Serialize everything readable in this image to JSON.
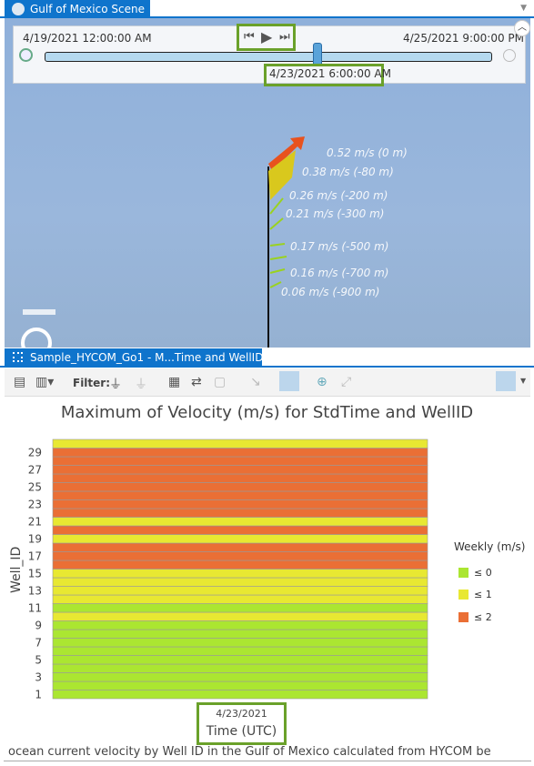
{
  "scene_tab": {
    "title": "Gulf of Mexico Scene",
    "close": "✕"
  },
  "time_slider": {
    "start": "4/19/2021 12:00:00 AM",
    "end": "4/25/2021 9:00:00 PM",
    "current": "4/23/2021 6:00:00 AM",
    "position_fraction": 0.61,
    "prev": "⏮",
    "play": "▶",
    "next": "⏭"
  },
  "scene_labels": [
    "0.52 m/s (0 m)",
    "0.38 m/s (-80 m)",
    "0.26 m/s (-200 m)",
    "0.21 m/s (-300 m)",
    "0.17 m/s (-500 m)",
    "0.16 m/s (-700 m)",
    "0.06 m/s (-900 m)"
  ],
  "chart_tab": {
    "title": "Sample_HYCOM_Go1 - M...Time and WellID",
    "close": "✕"
  },
  "toolbar": {
    "filter_label": "Filter:"
  },
  "chart_data": {
    "type": "heatmap",
    "title": "Maximum of Velocity (m/s) for StdTime and WellID",
    "xlabel": "Time (UTC)",
    "ylabel": "Well_ID",
    "x_categories": [
      "4/23/2021"
    ],
    "y_ticks": [
      "1",
      "3",
      "5",
      "7",
      "9",
      "11",
      "13",
      "15",
      "17",
      "19",
      "21",
      "23",
      "25",
      "27",
      "29"
    ],
    "well_ids": [
      1,
      2,
      3,
      4,
      5,
      6,
      7,
      8,
      9,
      10,
      11,
      12,
      13,
      14,
      15,
      16,
      17,
      18,
      19,
      20,
      21,
      22,
      23,
      24,
      25,
      26,
      27,
      28,
      29,
      30
    ],
    "class_index": [
      0,
      0,
      0,
      0,
      0,
      0,
      0,
      0,
      0,
      1,
      0,
      1,
      1,
      1,
      1,
      2,
      2,
      2,
      1,
      2,
      1,
      2,
      2,
      2,
      2,
      2,
      2,
      2,
      2,
      1
    ],
    "legend": {
      "title": "Weekly (m/s)",
      "placement": "right",
      "classes": [
        {
          "label": "≤ 0",
          "color": "#abe631"
        },
        {
          "label": "≤ 1",
          "color": "#e8e832"
        },
        {
          "label": "≤ 2",
          "color": "#ea6f35"
        }
      ]
    }
  },
  "caption": "ocean current velocity by Well ID in the Gulf of Mexico calculated from HYCOM be"
}
